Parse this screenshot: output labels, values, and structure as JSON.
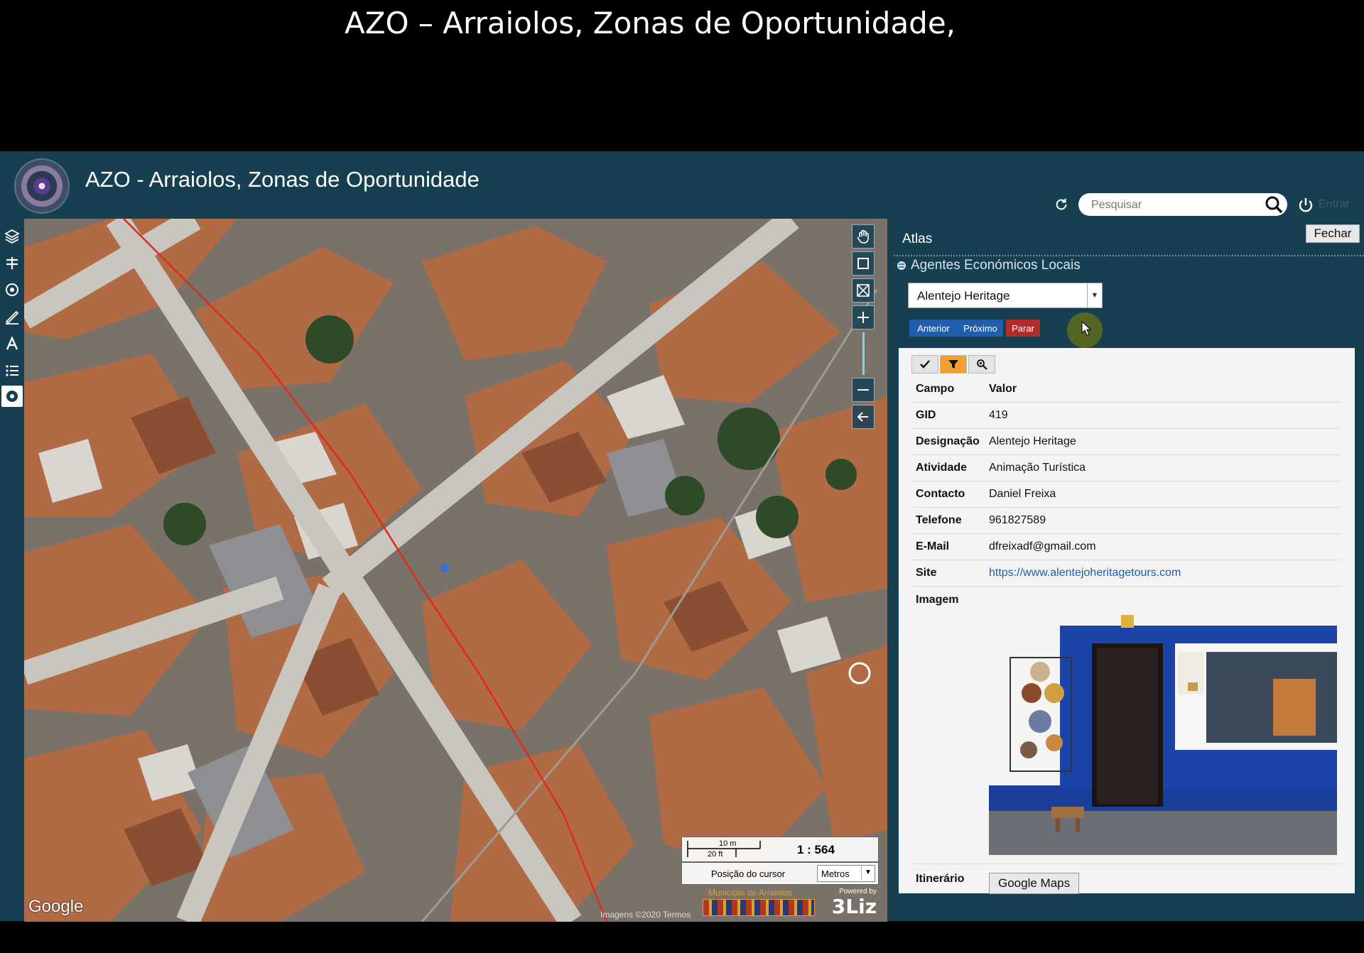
{
  "video": {
    "title": "AZO – Arraiolos, Zonas de Oportunidade,"
  },
  "header": {
    "app_title": "AZO - Arraiolos, Zonas de Oportunidade",
    "search_placeholder": "Pesquisar",
    "login_label": "Entrar"
  },
  "left_toolbar": [
    "layers-icon",
    "baselayers-icon",
    "locate-icon",
    "measure-icon",
    "atlas-icon",
    "legend-icon",
    "info-icon"
  ],
  "map": {
    "google_label": "Google",
    "attribution": "Imagens ©2020 Termos",
    "scale_metric": "10 m",
    "scale_imperial": "20 ft",
    "scale_ratio": "1 : 564",
    "cursor_label": "Posição do cursor",
    "units_selected": "Metros",
    "municipality_label": "Município de Arraiolos",
    "powered_by": "Powered by",
    "powered_brand": "3Liz"
  },
  "panel": {
    "title": "Atlas",
    "close_label": "Fechar",
    "layer_name": "Agentes Económicos Locais",
    "selected_feature": "Alentejo Heritage",
    "prev_label": "Anterior",
    "next_label": "Próximo",
    "stop_label": "Parar"
  },
  "popup": {
    "col_field": "Campo",
    "col_value": "Valor",
    "rows": [
      {
        "field": "GID",
        "value": "419"
      },
      {
        "field": "Designação",
        "value": "Alentejo Heritage"
      },
      {
        "field": "Atividade",
        "value": "Animação Turística"
      },
      {
        "field": "Contacto",
        "value": "Daniel Freixa"
      },
      {
        "field": "Telefone",
        "value": "961827589"
      },
      {
        "field": "E-Mail",
        "value": "dfreixadf@gmail.com"
      }
    ],
    "site_field": "Site",
    "site_value": "https://www.alentejoheritagetours.com",
    "image_field": "Imagem",
    "route_field": "Itinerário",
    "route_button": "Google Maps"
  },
  "colors": {
    "app_bg": "#173f52",
    "prev_next_btn": "#1f5fb0",
    "stop_btn": "#b52a2a",
    "link": "#1a5ea8",
    "filter_active": "#f0a030"
  }
}
